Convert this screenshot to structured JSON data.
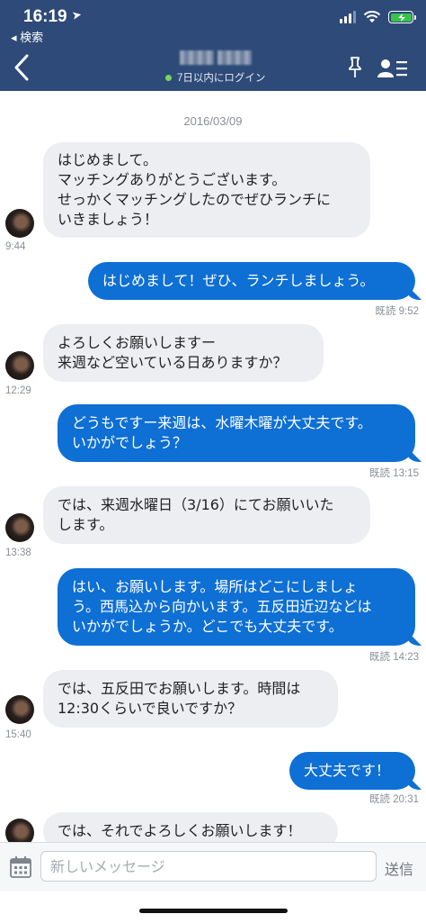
{
  "status_bar": {
    "time": "16:19",
    "back_label": "◂ 検索"
  },
  "header": {
    "login_status": "7日以内にログイン"
  },
  "chat": {
    "date": "2016/03/09",
    "messages": [
      {
        "side": "in",
        "text": "はじめまして。\nマッチングありがとうございます。\nせっかくマッチングしたのでぜひランチに\nいきましょう！",
        "time": "9:44"
      },
      {
        "side": "out",
        "text": "はじめまして！ぜひ、ランチしましょう。",
        "time": "既読 9:52"
      },
      {
        "side": "in",
        "text": "よろしくお願いしますー\n来週など空いている日ありますか？",
        "time": "12:29"
      },
      {
        "side": "out",
        "text": "どうもですー来週は、水曜木曜が大丈夫です。\nいかがでしょう？",
        "time": "既読 13:15"
      },
      {
        "side": "in",
        "text": "では、来週水曜日（3/16）にてお願いいた\nします。",
        "time": "13:38"
      },
      {
        "side": "out",
        "text": "はい、お願いします。場所はどこにしましょ\nう。西馬込から向かいます。五反田近辺などは\nいかがでしょうか。どこでも大丈夫です。",
        "time": "既読 14:23"
      },
      {
        "side": "in",
        "text": "では、五反田でお願いします。時間は\n12:30くらいで良いですか？",
        "time": "15:40"
      },
      {
        "side": "out",
        "text": "大丈夫です！",
        "time": "既読 20:31"
      },
      {
        "side": "in",
        "text": "では、それでよろしくお願いします！",
        "time": ""
      }
    ]
  },
  "input": {
    "placeholder": "新しいメッセージ",
    "send_label": "送信"
  },
  "colors": {
    "header": "#2d4a78",
    "outgoing": "#0e6fd4",
    "incoming": "#eceef2"
  }
}
